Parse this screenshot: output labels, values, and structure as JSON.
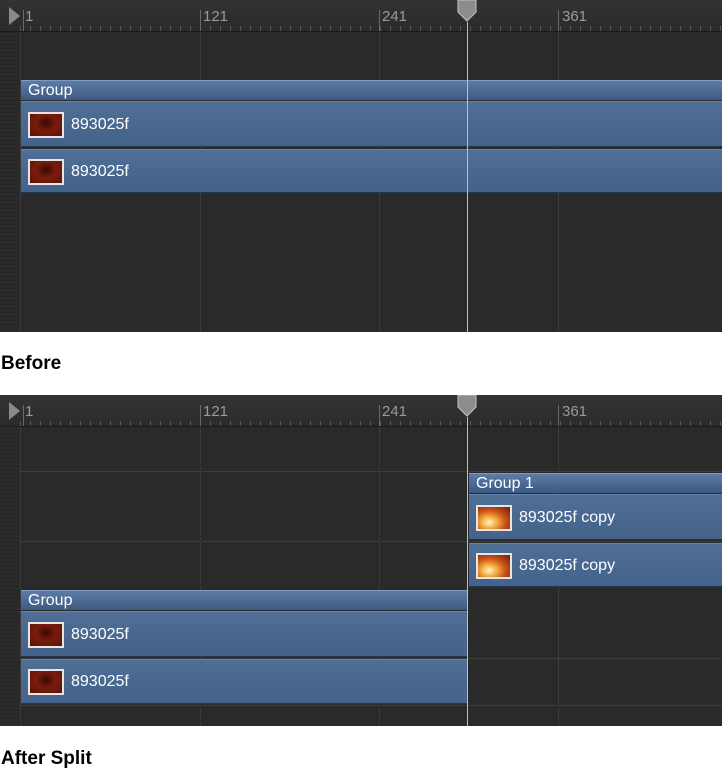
{
  "ruler": {
    "labels": [
      "1",
      "121",
      "241",
      "361"
    ]
  },
  "before": {
    "group_label": "Group",
    "tracks": [
      {
        "name": "893025f"
      },
      {
        "name": "893025f"
      }
    ],
    "caption": "Before"
  },
  "after": {
    "group_label": "Group",
    "tracks": [
      {
        "name": "893025f"
      },
      {
        "name": "893025f"
      }
    ],
    "split_group_label": "Group 1",
    "split_tracks": [
      {
        "name": "893025f copy"
      },
      {
        "name": "893025f copy"
      }
    ],
    "caption": "After Split"
  },
  "icons": {
    "start_marker": "play-start-triangle-icon",
    "playhead": "playhead-handle-icon"
  },
  "colors": {
    "track_blue": "#4a6891",
    "panel_bg": "#2a2a2a",
    "playhead": "#bfbfbf"
  }
}
